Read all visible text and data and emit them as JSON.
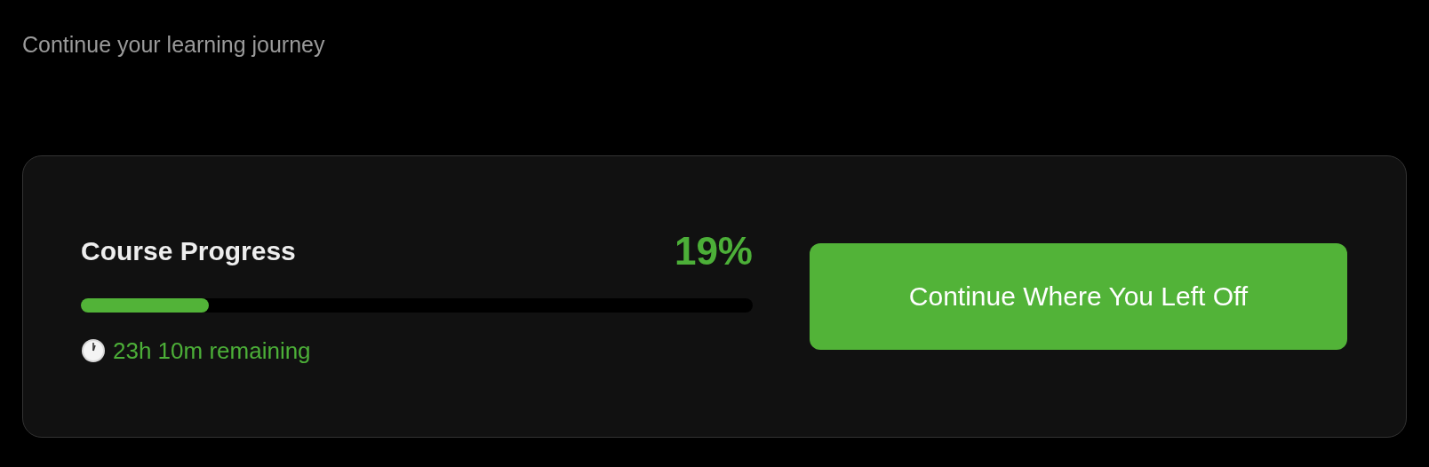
{
  "subtitle": "Continue your learning journey",
  "progress": {
    "title": "Course Progress",
    "percent": "19%",
    "level": 0.19,
    "remaining": "23h 10m remaining"
  },
  "button": "Continue Where You Left Off"
}
